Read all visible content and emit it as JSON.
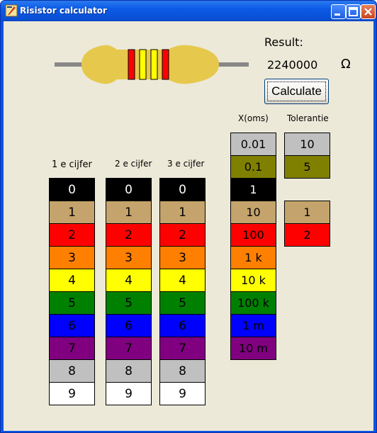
{
  "window": {
    "title": "Risistor calculator",
    "icon": "tk-feather-icon"
  },
  "result": {
    "label": "Result:",
    "value": "2240000",
    "unit": "Ω",
    "calculate_label": "Calculate"
  },
  "resistor": {
    "body_color": "#e6c84c",
    "lead_color": "#888888",
    "bands": [
      "#ff0000",
      "#ffff00",
      "#ffff00",
      "#ff0000"
    ]
  },
  "headers": {
    "digit1": "1 e cijfer",
    "digit2": "2 e cijfer",
    "digit3": "3 e cijfer",
    "multiplier": "X(oms)",
    "tolerance": "Tolerantie"
  },
  "digits": [
    {
      "label": "0",
      "color": "#000000",
      "text_color": "#ffffff"
    },
    {
      "label": "1",
      "color": "#c4a46c",
      "text_color": "#000000"
    },
    {
      "label": "2",
      "color": "#ff0000",
      "text_color": "#000000"
    },
    {
      "label": "3",
      "color": "#ff8000",
      "text_color": "#000000"
    },
    {
      "label": "4",
      "color": "#ffff00",
      "text_color": "#000000"
    },
    {
      "label": "5",
      "color": "#008000",
      "text_color": "#000000"
    },
    {
      "label": "6",
      "color": "#0000ff",
      "text_color": "#000000"
    },
    {
      "label": "7",
      "color": "#800080",
      "text_color": "#000000"
    },
    {
      "label": "8",
      "color": "#c0c0c0",
      "text_color": "#000000"
    },
    {
      "label": "9",
      "color": "#ffffff",
      "text_color": "#000000"
    }
  ],
  "multipliers": [
    {
      "label": "0.01",
      "color": "#c0c0c0",
      "text_color": "#000000"
    },
    {
      "label": "0.1",
      "color": "#808000",
      "text_color": "#000000"
    },
    {
      "label": "1",
      "color": "#000000",
      "text_color": "#ffffff"
    },
    {
      "label": "10",
      "color": "#c4a46c",
      "text_color": "#000000"
    },
    {
      "label": "100",
      "color": "#ff0000",
      "text_color": "#000000"
    },
    {
      "label": "1 k",
      "color": "#ff8000",
      "text_color": "#000000"
    },
    {
      "label": "10 k",
      "color": "#ffff00",
      "text_color": "#000000"
    },
    {
      "label": "100 k",
      "color": "#008000",
      "text_color": "#000000"
    },
    {
      "label": "1 m",
      "color": "#0000ff",
      "text_color": "#000000"
    },
    {
      "label": "10 m",
      "color": "#800080",
      "text_color": "#000000"
    }
  ],
  "tolerances": [
    {
      "label": "10",
      "color": "#c0c0c0",
      "text_color": "#000000"
    },
    {
      "label": "5",
      "color": "#808000",
      "text_color": "#000000"
    },
    {
      "label": "1",
      "color": "#c4a46c",
      "text_color": "#000000"
    },
    {
      "label": "2",
      "color": "#ff0000",
      "text_color": "#000000"
    }
  ]
}
